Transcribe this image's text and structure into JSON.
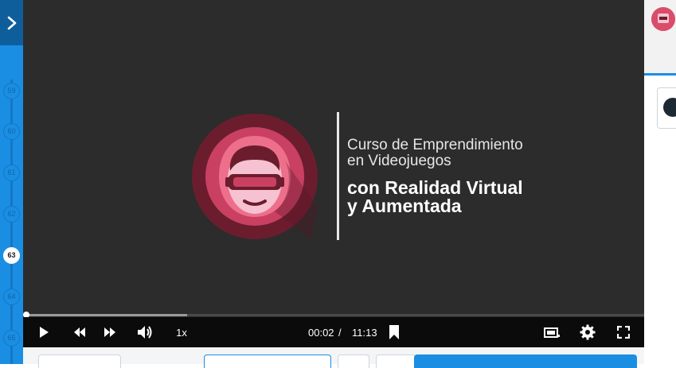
{
  "sidebar": {
    "expand_icon": "chevron-right-icon",
    "lessons": [
      {
        "number": "59",
        "active": false
      },
      {
        "number": "60",
        "active": false
      },
      {
        "number": "61",
        "active": false
      },
      {
        "number": "62",
        "active": false
      },
      {
        "number": "63",
        "active": true
      },
      {
        "number": "64",
        "active": false
      },
      {
        "number": "65",
        "active": false
      }
    ]
  },
  "video": {
    "title_line1": "Curso de Emprendimiento",
    "title_line2": "en Videojuegos",
    "title_line3": "con Realidad Virtual",
    "title_line4": "y Aumentada",
    "progress": 0.003,
    "buffered": 0.26,
    "background_color": "#2c2c2c",
    "logo_colors": {
      "outer": "#6b1d2e",
      "ring": "#c94063",
      "inner": "#ee6f8b",
      "face": "#f6c2d1"
    }
  },
  "player_controls": {
    "speed_label": "1x",
    "current_time": "00:02",
    "time_separator": "/",
    "duration": "11:13",
    "icons": [
      "play-icon",
      "rewind-icon",
      "fast-forward-icon",
      "volume-icon",
      "bookmark-icon",
      "theater-mode-icon",
      "settings-gear-icon",
      "fullscreen-icon"
    ]
  },
  "colors": {
    "sidebar_blue": "#1a8ee2",
    "sidebar_dark": "#0f5e9c",
    "control_bar": "#0b0b0b"
  }
}
